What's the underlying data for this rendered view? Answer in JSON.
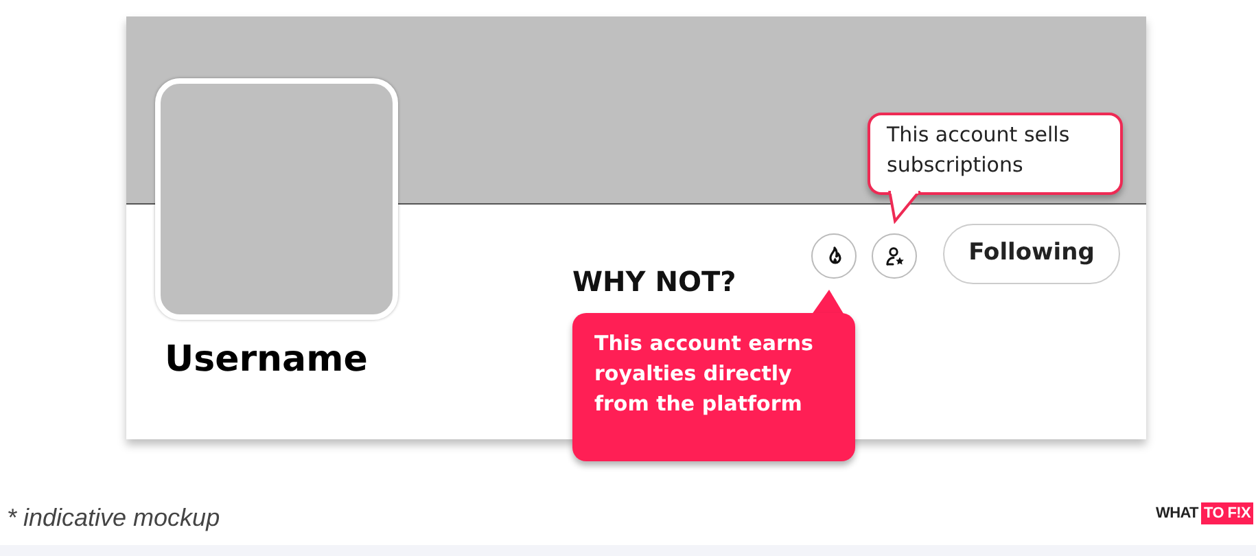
{
  "profile": {
    "username": "Username",
    "display_name": "WHY NOT?",
    "badges": [
      {
        "kind": "flame"
      },
      {
        "kind": "person-star"
      }
    ],
    "follow_button": {
      "label": "Following"
    }
  },
  "tooltips": [
    {
      "kind": "outline",
      "text": "This account sells subscriptions"
    },
    {
      "kind": "filled",
      "text": "This account earns royalties directly from the platform"
    }
  ],
  "caption": "* indicative mockup",
  "logo": {
    "part_1": "WHAT",
    "part_2": "TO F!X"
  }
}
